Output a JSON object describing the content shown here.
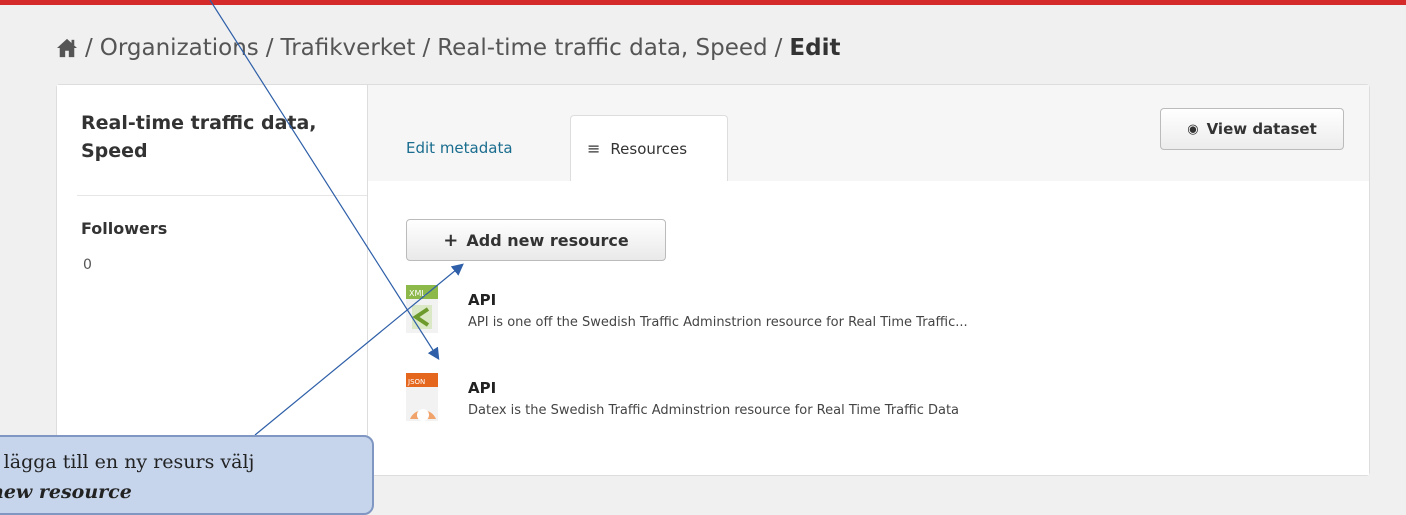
{
  "breadcrumb": {
    "items": [
      "Organizations",
      "Trafikverket",
      "Real-time traffic data, Speed"
    ],
    "current": "Edit",
    "separator": "/"
  },
  "sidebar": {
    "title": "Real-time traffic data, Speed",
    "followers_label": "Followers",
    "followers_count": "0"
  },
  "tabs": [
    {
      "label": "Edit metadata",
      "active": false
    },
    {
      "label": "Resources",
      "active": true,
      "icon": "menu-icon"
    }
  ],
  "actions": {
    "view_dataset": "View dataset",
    "add_resource": "Add new resource"
  },
  "resources": [
    {
      "format": "XML",
      "name": "API",
      "description": "API is one off the Swedish Traffic Adminstrion resource for Real Time Traffic..."
    },
    {
      "format": "JSON",
      "name": "API",
      "description": "Datex is the Swedish Traffic Adminstrion resource for Real Time Traffic Data"
    }
  ],
  "callout": {
    "line1": "t lägga till en ny resurs välj",
    "line2": "new resource"
  },
  "colors": {
    "accent_bar": "#d42a2a",
    "link": "#1a6d8f",
    "callout_fill": "#c6d5ec",
    "callout_border": "#7f97c2",
    "arrow": "#2e5fa8"
  }
}
